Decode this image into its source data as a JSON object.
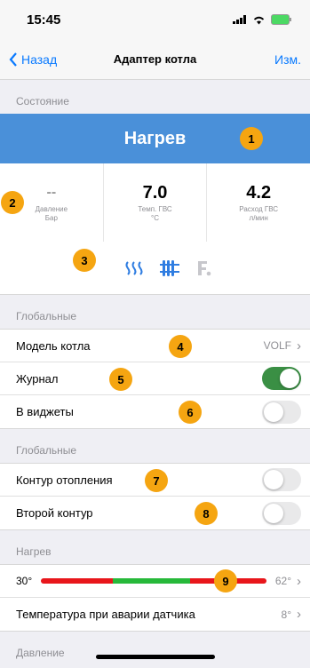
{
  "status": {
    "time": "15:45"
  },
  "nav": {
    "back": "Назад",
    "title": "Адаптер котла",
    "edit": "Изм."
  },
  "state_section": {
    "header": "Состояние",
    "value": "Нагрев"
  },
  "metrics": [
    {
      "value": "--",
      "label1": "Давление",
      "label2": "Бар"
    },
    {
      "value": "7.0",
      "label1": "Темп. ГВС",
      "label2": "°C"
    },
    {
      "value": "4.2",
      "label1": "Расход ГВС",
      "label2": "л/мин"
    }
  ],
  "global1": {
    "header": "Глобальные",
    "model_label": "Модель котла",
    "model_value": "VOLF",
    "journal_label": "Журнал",
    "journal_on": true,
    "widgets_label": "В виджеты",
    "widgets_on": false
  },
  "global2": {
    "header": "Глобальные",
    "heating_label": "Контур отопления",
    "heating_on": false,
    "second_label": "Второй контур",
    "second_on": false
  },
  "heating": {
    "header": "Нагрев",
    "min": "30°",
    "max": "62°",
    "fault_label": "Температура при аварии датчика",
    "fault_value": "8°"
  },
  "pressure": {
    "header": "Давление"
  },
  "badges": [
    "1",
    "2",
    "3",
    "4",
    "5",
    "6",
    "7",
    "8",
    "9"
  ],
  "colors": {
    "accent": "#0a7aff",
    "state_bg": "#4a90d9",
    "badge": "#f5a511",
    "toggle_on": "#3a8f44",
    "red": "#e8161b",
    "green": "#27b93a"
  }
}
